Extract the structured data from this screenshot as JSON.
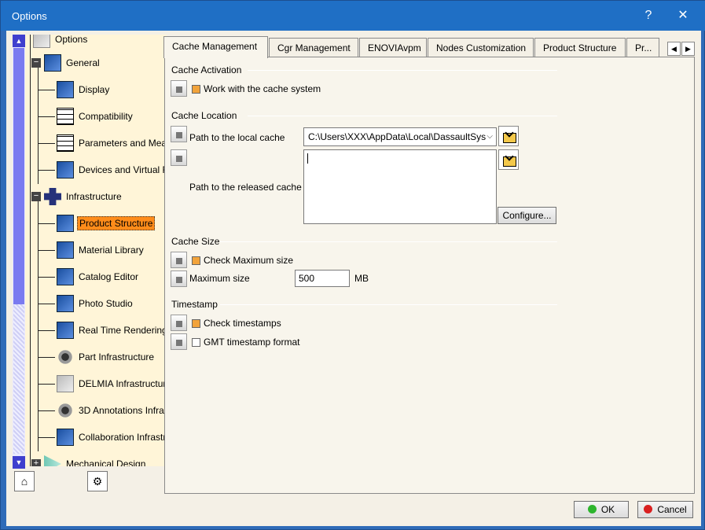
{
  "window": {
    "title": "Options",
    "help_label": "?",
    "close_label": "✕"
  },
  "tree": {
    "items": [
      {
        "label": "Options",
        "icon": "options-root-icon"
      },
      {
        "label": "General",
        "icon": "general-icon"
      },
      {
        "label": "Display",
        "icon": "display-icon"
      },
      {
        "label": "Compatibility",
        "icon": "compatibility-icon"
      },
      {
        "label": "Parameters and Measu",
        "icon": "parameters-icon"
      },
      {
        "label": "Devices and Virtual Re",
        "icon": "devices-icon"
      },
      {
        "label": "Infrastructure",
        "icon": "infrastructure-icon"
      },
      {
        "label": "Product Structure",
        "icon": "product-structure-icon"
      },
      {
        "label": "Material Library",
        "icon": "material-library-icon"
      },
      {
        "label": "Catalog Editor",
        "icon": "catalog-editor-icon"
      },
      {
        "label": "Photo Studio",
        "icon": "photo-studio-icon"
      },
      {
        "label": "Real Time Rendering",
        "icon": "real-time-rendering-icon"
      },
      {
        "label": "Part Infrastructure",
        "icon": "part-infrastructure-icon"
      },
      {
        "label": "DELMIA Infrastructure",
        "icon": "delmia-icon"
      },
      {
        "label": "3D Annotations Infra",
        "icon": "annotations-icon"
      },
      {
        "label": "Collaboration Infrastr",
        "icon": "collaboration-icon"
      },
      {
        "label": "Mechanical Design",
        "icon": "mechanical-design-icon"
      }
    ],
    "selected": "Product Structure"
  },
  "tabs": [
    {
      "label": "Cache Management",
      "active": true
    },
    {
      "label": "Cgr Management"
    },
    {
      "label": "ENOVIAvpm"
    },
    {
      "label": "Nodes Customization"
    },
    {
      "label": "Product Structure"
    },
    {
      "label": "Pr..."
    }
  ],
  "cache_activation": {
    "title": "Cache Activation",
    "work_with_cache": {
      "label": "Work with the cache system",
      "checked": true
    }
  },
  "cache_location": {
    "title": "Cache Location",
    "local_label": "Path to the local cache",
    "local_value": "C:\\Users\\XXX\\AppData\\Local\\DassaultSys",
    "released_label": "Path to the released cache",
    "configure_label": "Configure..."
  },
  "cache_size": {
    "title": "Cache Size",
    "check_max": {
      "label": "Check Maximum size",
      "checked": true
    },
    "max_label": "Maximum size",
    "max_value": "500",
    "unit": "MB"
  },
  "timestamp": {
    "title": "Timestamp",
    "check_ts": {
      "label": "Check timestamps",
      "checked": true
    },
    "gmt": {
      "label": "GMT timestamp format",
      "checked": false
    }
  },
  "footer": {
    "ok_label": "OK",
    "cancel_label": "Cancel"
  },
  "colors": {
    "accent_selected": "#ff8c1a",
    "checkbox_on": "#f2a33a",
    "titlebar": "#1f6fc5"
  }
}
